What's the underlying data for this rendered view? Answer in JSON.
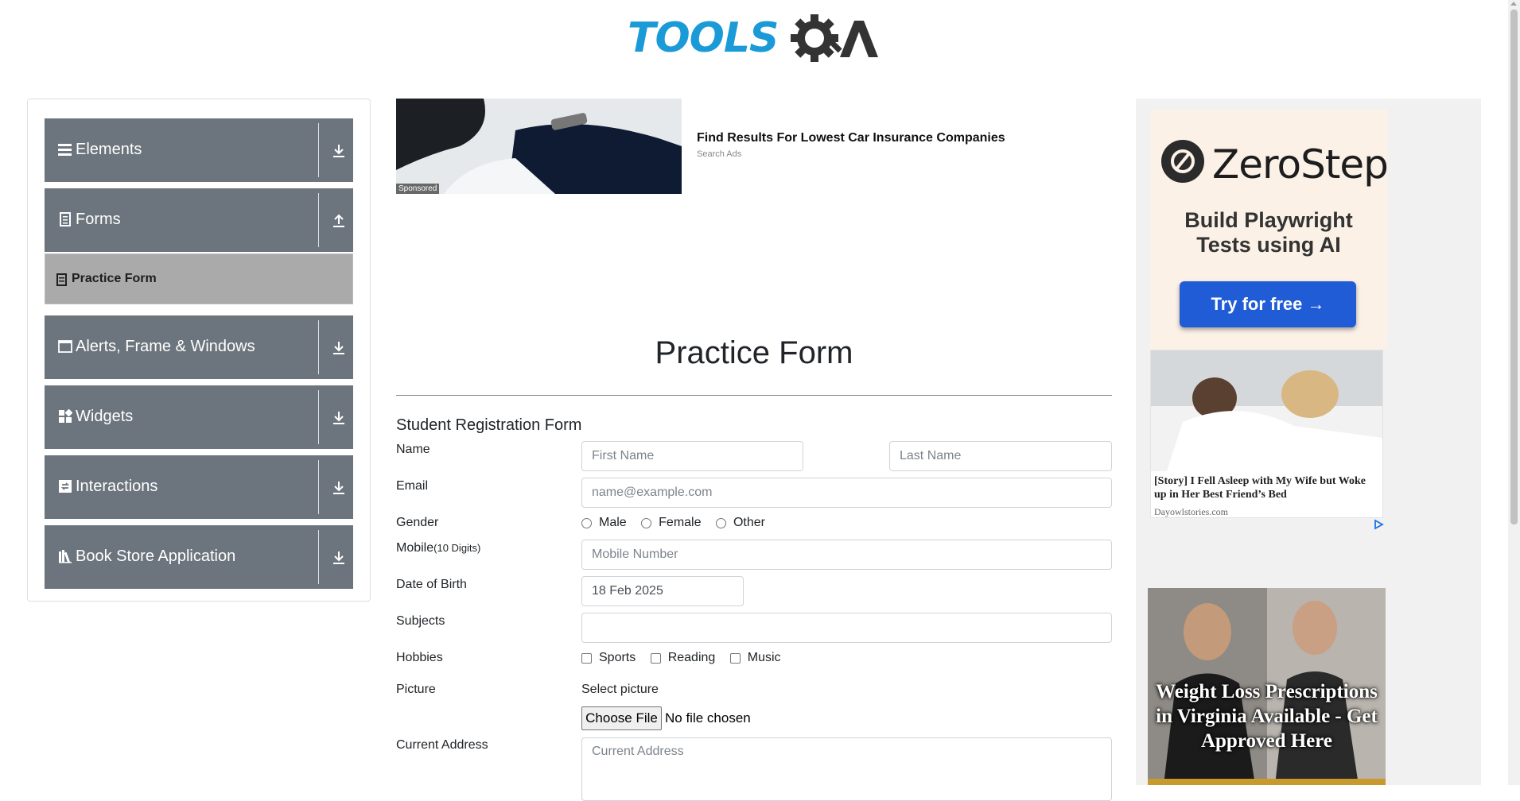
{
  "header": {
    "logo_text": "TOOLSQA"
  },
  "sidebar": {
    "groups": [
      {
        "label": "Elements",
        "icon": "menu-icon",
        "arrow": "download-arrow-icon"
      },
      {
        "label": "Forms",
        "icon": "document-icon",
        "arrow": "upload-arrow-icon"
      },
      {
        "label": "Alerts, Frame & Windows",
        "icon": "window-icon",
        "arrow": "download-arrow-icon"
      },
      {
        "label": "Widgets",
        "icon": "grid-icon",
        "arrow": "download-arrow-icon"
      },
      {
        "label": "Interactions",
        "icon": "interaction-icon",
        "arrow": "download-arrow-icon"
      },
      {
        "label": "Book Store Application",
        "icon": "library-icon",
        "arrow": "download-arrow-icon"
      }
    ],
    "active_item": {
      "label": "Practice Form",
      "icon": "form-icon"
    }
  },
  "top_ad": {
    "sponsored": "Sponsored",
    "headline": "Find Results For Lowest Car Insurance Companies",
    "source": "Search Ads"
  },
  "form": {
    "page_title": "Practice Form",
    "section_title": "Student Registration Form",
    "name_label": "Name",
    "first_name_placeholder": "First Name",
    "last_name_placeholder": "Last Name",
    "email_label": "Email",
    "email_placeholder": "name@example.com",
    "gender_label": "Gender",
    "gender_options": [
      "Male",
      "Female",
      "Other"
    ],
    "mobile_label": "Mobile",
    "mobile_hint": "(10 Digits)",
    "mobile_placeholder": "Mobile Number",
    "dob_label": "Date of Birth",
    "dob_value": "18 Feb 2025",
    "subjects_label": "Subjects",
    "subjects_value": "",
    "hobbies_label": "Hobbies",
    "hobbies_options": [
      "Sports",
      "Reading",
      "Music"
    ],
    "picture_label": "Picture",
    "picture_hint": "Select picture",
    "choose_file": "Choose File",
    "no_file": "No file chosen",
    "address_label": "Current Address",
    "address_placeholder": "Current Address"
  },
  "right_ads": {
    "zerostep": {
      "brand": "ZeroStep",
      "tagline_line1": "Build Playwright",
      "tagline_line2": "Tests using AI",
      "cta": "Try for free →"
    },
    "story": {
      "title": "[Story] I Fell Asleep with My Wife but Woke up in Her Best Friend’s Bed",
      "source": "Dayowlstories.com"
    },
    "weight_loss": {
      "text": "Weight Loss Prescriptions in Virginia Available - Get Approved Here"
    }
  },
  "colors": {
    "sidebar_group_bg": "#6c757d",
    "sidebar_active_bg": "#aaaaaa",
    "logo_blue": "#1a9ad6",
    "cta_blue": "#1f5cd6"
  }
}
